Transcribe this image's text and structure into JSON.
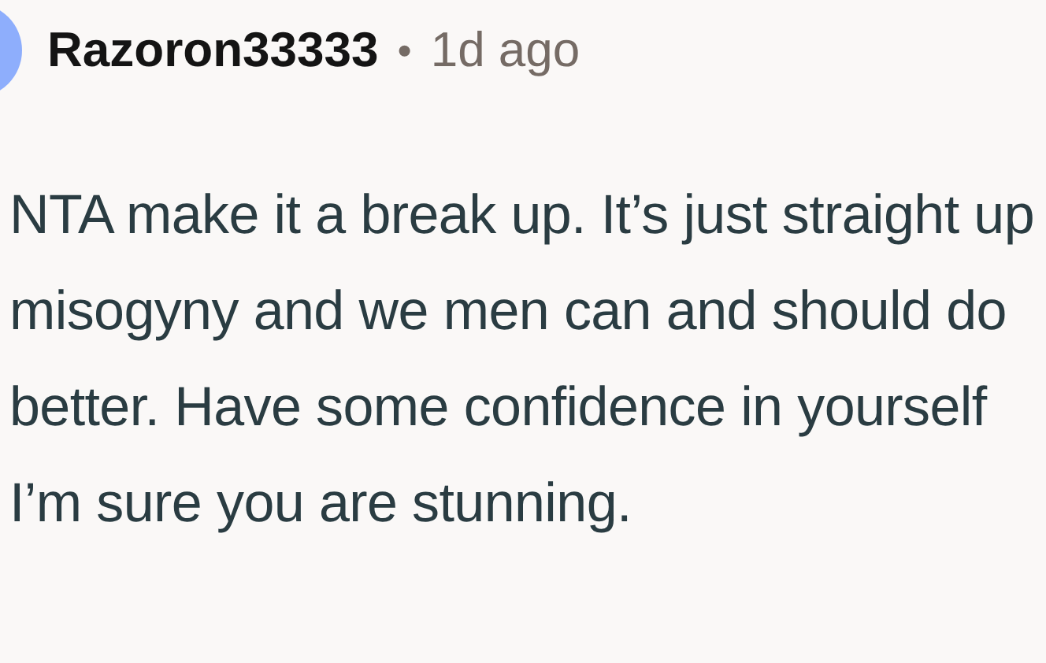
{
  "comment": {
    "author": "Razoron33333",
    "separator": "•",
    "time": "1d ago",
    "body": "NTA make it a break up. It’s just straight up misogyny and we men can and should do better. Have some confidence in yourself I’m sure you are stunning."
  }
}
